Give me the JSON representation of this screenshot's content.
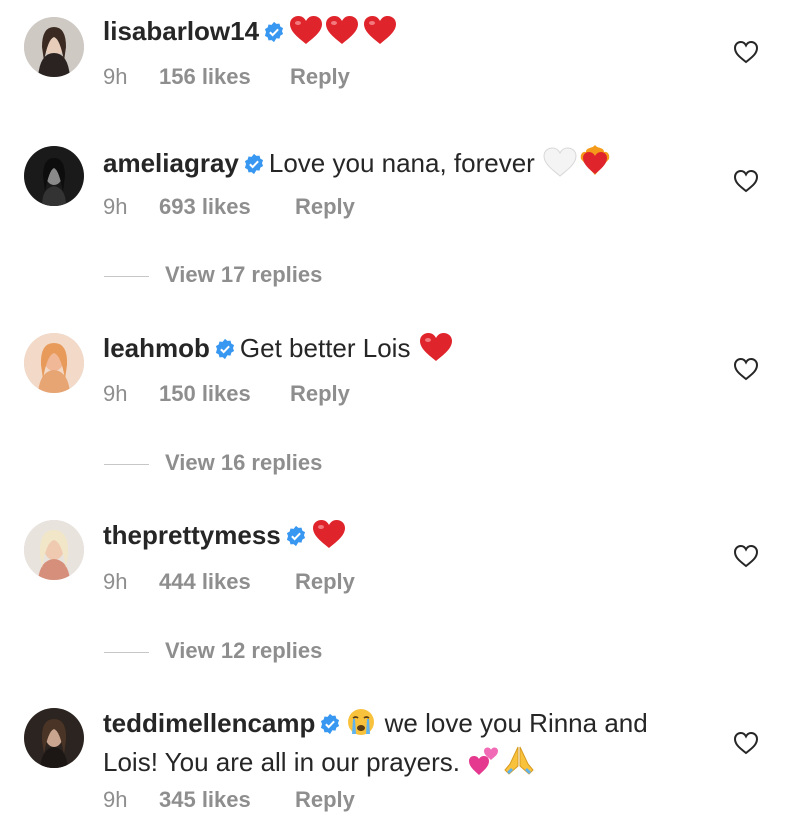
{
  "comments": [
    {
      "username": "lisabarlow14",
      "text": "",
      "emojis": [
        "red-heart",
        "red-heart",
        "red-heart"
      ],
      "time": "9h",
      "likes": "156 likes",
      "reply": "Reply",
      "view_replies": ""
    },
    {
      "username": "ameliagray",
      "text": "Love you nana, forever",
      "emojis": [
        "white-heart",
        "heart-on-fire"
      ],
      "time": "9h",
      "likes": "693 likes",
      "reply": "Reply",
      "view_replies": "View 17 replies"
    },
    {
      "username": "leahmob",
      "text": "Get better Lois",
      "emojis": [
        "red-heart"
      ],
      "time": "9h",
      "likes": "150 likes",
      "reply": "Reply",
      "view_replies": "View 16 replies"
    },
    {
      "username": "theprettymess",
      "text": "",
      "emojis": [
        "red-heart"
      ],
      "time": "9h",
      "likes": "444 likes",
      "reply": "Reply",
      "view_replies": "View 12 replies"
    },
    {
      "username": "teddimellencamp",
      "text_before": "we love you Rinna and",
      "text_line2": "Lois! You are all in our prayers.",
      "emojis": [
        "crying-face",
        "two-hearts",
        "folded-hands"
      ],
      "time": "9h",
      "likes": "345 likes",
      "reply": "Reply"
    }
  ],
  "colors": {
    "text": "#262626",
    "muted": "#8e8e8e",
    "verified_blue": "#3897f0",
    "heart_red": "#e0242b"
  },
  "icons": [
    "verified-badge-icon",
    "like-heart-outline-icon"
  ]
}
